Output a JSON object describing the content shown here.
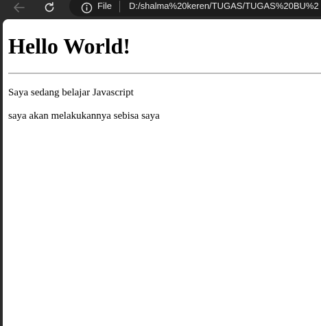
{
  "browser": {
    "protocol_label": "File",
    "url": "D:/shalma%20keren/TUGAS/TUGAS%20BU%2"
  },
  "page": {
    "heading": "Hello World!",
    "paragraphs": [
      "Saya sedang belajar Javascript",
      "saya akan melakukannya sebisa saya"
    ]
  }
}
